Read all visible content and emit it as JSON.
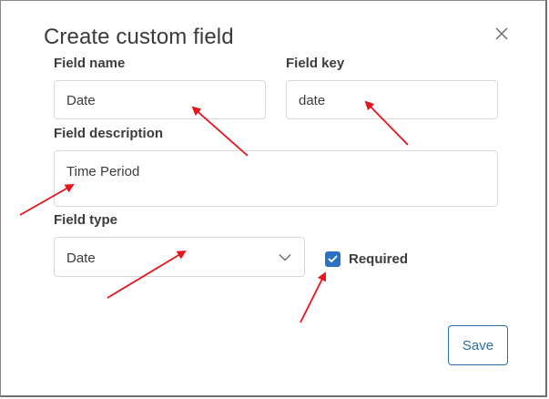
{
  "dialog": {
    "title": "Create custom field",
    "fields": {
      "name": {
        "label": "Field name",
        "value": "Date"
      },
      "key": {
        "label": "Field key",
        "value": "date"
      },
      "description": {
        "label": "Field description",
        "value": "Time Period"
      },
      "type": {
        "label": "Field type",
        "selected": "Date"
      }
    },
    "required": {
      "label": "Required",
      "checked": true
    },
    "save_label": "Save"
  },
  "icons": {
    "close": "close-icon",
    "dropdown": "chevron-down-icon",
    "check": "check-icon"
  },
  "colors": {
    "accent": "#2b71c4",
    "button_border": "#2c6ea8",
    "annotation_arrow": "#e8141b"
  }
}
